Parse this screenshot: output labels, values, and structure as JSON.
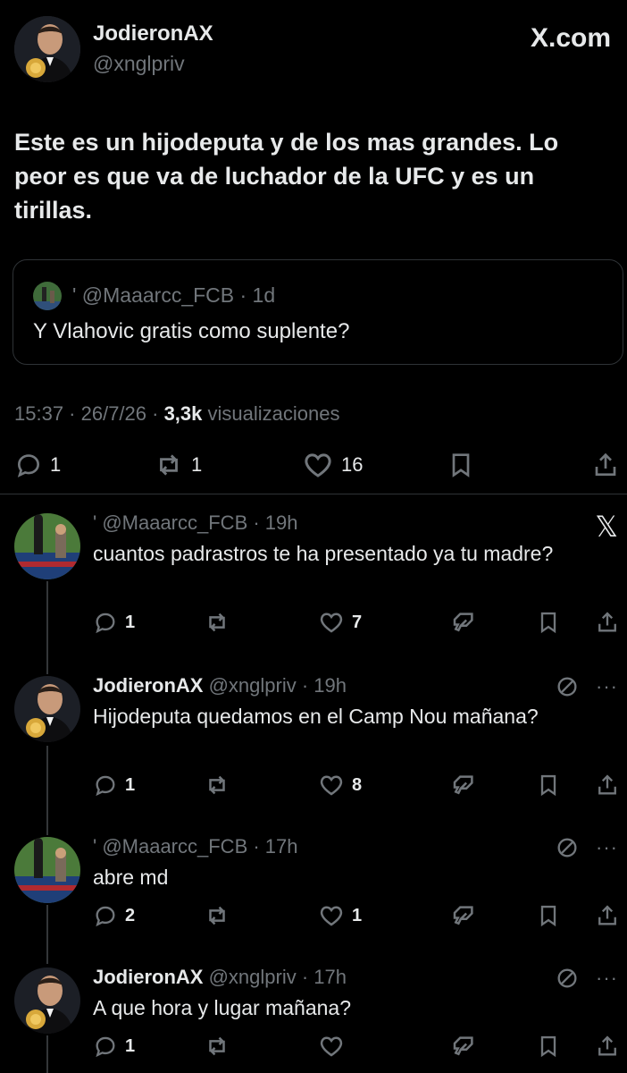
{
  "main": {
    "name": "JodieronAX",
    "handle": "@xnglpriv",
    "brand": "X.com",
    "text": "Este es un hijodeputa y de los mas grandes. Lo peor es que va de luchador de la UFC y es un tirillas.",
    "quote": {
      "head": "' @Maaarcc_FCB · 1d",
      "text": "Y Vlahovic gratis como suplente?"
    },
    "meta": {
      "time": "15:37 · 26/7/26 · ",
      "views_count": "3,3k",
      "views_label": " visualizaciones"
    },
    "actions": {
      "replies": "1",
      "reposts": "1",
      "likes": "16"
    }
  },
  "replies": [
    {
      "name": "",
      "handle": "' @Maaarcc_FCB · 19h",
      "text": "cuantos padrastros te ha presentado ya tu madre?",
      "replies": "1",
      "reposts": "",
      "likes": "7"
    },
    {
      "name": "JodieronAX",
      "handle": "@xnglpriv · 19h",
      "text": "Hijodeputa quedamos en el Camp Nou mañana?",
      "replies": "1",
      "reposts": "",
      "likes": "8"
    },
    {
      "name": "",
      "handle": "' @Maaarcc_FCB · 17h",
      "text": "abre md",
      "replies": "2",
      "reposts": "",
      "likes": "1"
    },
    {
      "name": "JodieronAX",
      "handle": "@xnglpriv · 17h",
      "text": "A que hora y lugar mañana?",
      "replies": "1",
      "reposts": "",
      "likes": ""
    }
  ],
  "icons": [
    "reply-icon",
    "repost-icon",
    "like-icon",
    "bookmark-icon",
    "share-icon",
    "grok-icon",
    "more-icon",
    "x-logo-icon",
    "block-icon"
  ],
  "colors": {
    "background": "#000000",
    "text": "#e7e9ea",
    "muted": "#71767b",
    "border": "#2f3336"
  }
}
